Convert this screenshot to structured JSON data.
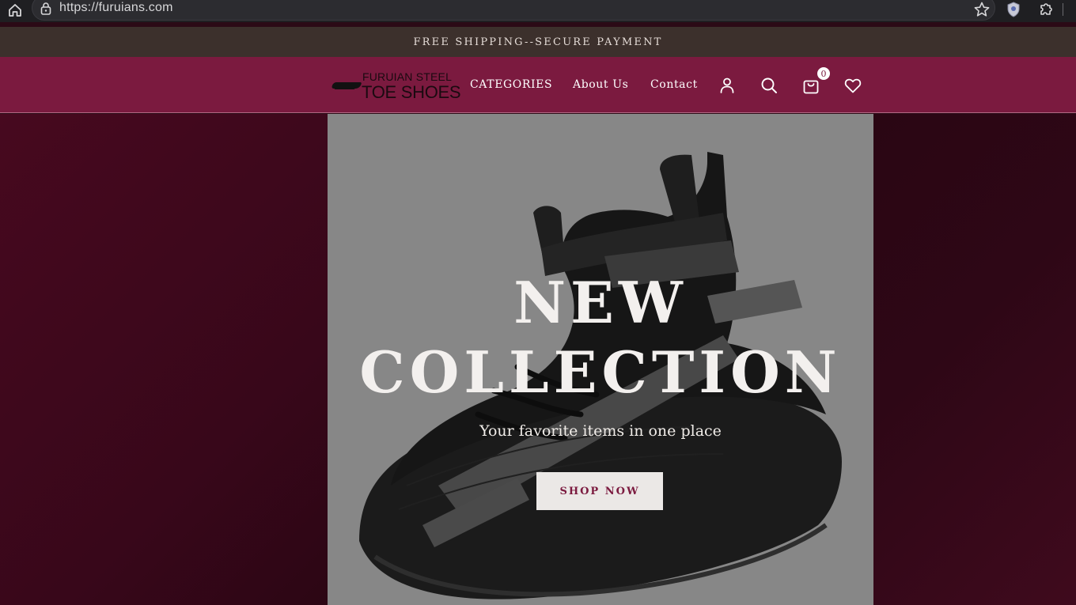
{
  "browser": {
    "url": "https://furuians.com"
  },
  "announcement": {
    "text": "FREE SHIPPING--SECURE PAYMENT"
  },
  "header": {
    "logo": {
      "line1": "FURUIAN STEEL",
      "line2": "TOE SHOES"
    },
    "nav": {
      "categories": "CATEGORIES",
      "about": "About Us",
      "contact": "Contact"
    },
    "icons": [
      "user-icon",
      "search-icon",
      "shopping-bag-icon",
      "heart-icon"
    ],
    "cart_count": "0"
  },
  "hero": {
    "title_line1": "NEW",
    "title_line2": "COLLECTION",
    "subtitle": "Your favorite items in one place",
    "cta": "SHOP NOW"
  },
  "colors": {
    "header_bg": "#7b1a3f",
    "announcement_bg": "#3c302c",
    "hero_panel_bg": "#878787",
    "page_bg": "#2b0a16",
    "cta_text": "#7b1a3f"
  }
}
